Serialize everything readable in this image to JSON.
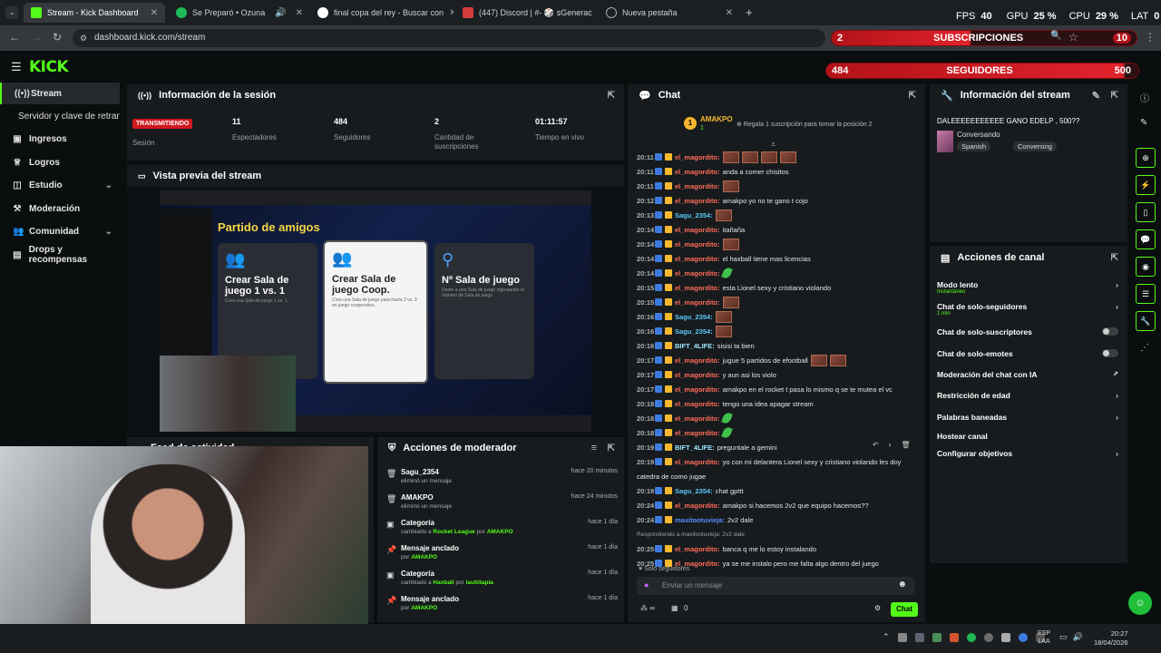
{
  "browser": {
    "tabs": [
      {
        "title": "Stream - Kick Dashboard"
      },
      {
        "title": "Se Preparó • Ozuna"
      },
      {
        "title": "final copa del rey - Buscar con"
      },
      {
        "title": "(447) Discord | #- 🎲 ꜱGenerac"
      },
      {
        "title": "Nueva pestaña"
      }
    ],
    "url": "dashboard.kick.com/stream",
    "new_tab": "+"
  },
  "overlay": {
    "fps_label": "FPS",
    "fps": "40",
    "gpu_label": "GPU",
    "gpu": "25 %",
    "cpu_label": "CPU",
    "cpu": "29 %",
    "lat_label": "LAT",
    "lat": "0",
    "subs_current": "2",
    "subs_label": "SUBSCRIPCIONES",
    "subs_goal": "10",
    "followers_current": "484",
    "followers_label": "SEGUIDORES",
    "followers_goal": "500"
  },
  "sidebar": {
    "items": [
      {
        "label": "Stream"
      },
      {
        "label": "Servidor y clave de retransm"
      },
      {
        "label": "Ingresos"
      },
      {
        "label": "Logros"
      },
      {
        "label": "Estudio"
      },
      {
        "label": "Moderación"
      },
      {
        "label": "Comunidad"
      },
      {
        "label": "Drops y recompensas"
      }
    ]
  },
  "session": {
    "title": "Información de la sesión",
    "status": "TRANSMITIENDO",
    "status_label": "Sesión",
    "viewers": "11",
    "viewers_label": "Espectadores",
    "followers": "484",
    "followers_label": "Seguidores",
    "subs": "2",
    "subs_label": "Cantidad de suscripciones",
    "live_time": "01:11:57",
    "live_label": "Tiempo en vivo"
  },
  "preview": {
    "title": "Vista previa del stream",
    "game_title": "Partido de amigos",
    "cards": [
      {
        "title": "Crear Sala de juego 1 vs. 1",
        "desc": "Crea una Sala de juego 1 vs. 1."
      },
      {
        "title": "Crear Sala de juego Coop.",
        "desc": "Crea una Sala de juego para hasta 3 vs. 3 en juego cooperativo."
      },
      {
        "title": "Nº Sala de juego",
        "desc": "Únete a una Sala de juego ingresando el número de Sala de juego."
      }
    ]
  },
  "activity_feed": {
    "title": "Feed de actividad"
  },
  "mod_actions": {
    "title": "Acciones de moderador",
    "items": [
      {
        "title": "Sagu_2354",
        "desc": "eliminó un mensaje",
        "when": "hace 20 minutos",
        "by": ""
      },
      {
        "title": "AMAKPO",
        "desc": "eliminó un mensaje",
        "when": "hace 24 minutos",
        "by": ""
      },
      {
        "title": "Categoría",
        "desc": "cambiado a",
        "target": "Rocket League",
        "by_word": "por",
        "by": "AMAKPO",
        "when": "hace 1 día"
      },
      {
        "title": "Mensaje anclado",
        "desc": "por",
        "by": "AMAKPO",
        "when": "hace 1 día"
      },
      {
        "title": "Categoría",
        "desc": "cambiado a",
        "target": "Haxball",
        "by_word": "por",
        "by": "lautiitapia",
        "when": "hace 1 día"
      },
      {
        "title": "Mensaje anclado",
        "desc": "por",
        "by": "AMAKPO",
        "when": "hace 1 día"
      }
    ]
  },
  "chat": {
    "title": "Chat",
    "top_gifter": "AMAKPO",
    "top_gifter_rank": "1",
    "top_gifter_count": "1",
    "gift_promo": "Regala 1 suscripción para tomar la posición 2",
    "messages": [
      {
        "time": "20:11",
        "user": "el_magordito",
        "color": "#ff6b5a",
        "text": "",
        "emotes": 4
      },
      {
        "time": "20:11",
        "user": "el_magordito",
        "color": "#ff6b5a",
        "text": "anda a comer chisitos"
      },
      {
        "time": "20:11",
        "user": "el_magordito",
        "color": "#ff6b5a",
        "text": "",
        "emotes": 1
      },
      {
        "time": "20:12",
        "user": "el_magordito",
        "color": "#ff6b5a",
        "text": "amakpo yo no te gano t cojo"
      },
      {
        "time": "20:13",
        "user": "Sagu_2354",
        "color": "#5ac8fa",
        "text": "",
        "emotes": 1
      },
      {
        "time": "20:14",
        "user": "el_magordito",
        "color": "#ff6b5a",
        "text": "itañaña"
      },
      {
        "time": "20:14",
        "user": "el_magordito",
        "color": "#ff6b5a",
        "text": "",
        "emotes": 1
      },
      {
        "time": "20:14",
        "user": "el_magordito",
        "color": "#ff6b5a",
        "text": "el haxball tiene mas licencias"
      },
      {
        "time": "20:14",
        "user": "el_magordito",
        "color": "#ff6b5a",
        "text": "",
        "leaf": true
      },
      {
        "time": "20:15",
        "user": "el_magordito",
        "color": "#ff6b5a",
        "text": "esta Lionel sexy y cristiano violando"
      },
      {
        "time": "20:15",
        "user": "el_magordito",
        "color": "#ff6b5a",
        "text": "",
        "emotes": 1
      },
      {
        "time": "20:16",
        "user": "Sagu_2354",
        "color": "#5ac8fa",
        "text": "",
        "emotes": 1
      },
      {
        "time": "20:16",
        "user": "Sagu_2354",
        "color": "#5ac8fa",
        "text": "",
        "emotes": 1
      },
      {
        "time": "20:16",
        "user": "BIFT_4LIFE",
        "color": "#9be7ff",
        "text": "sisisi ta bien"
      },
      {
        "time": "20:17",
        "user": "el_magordito",
        "color": "#ff6b5a",
        "text": "jugue 5 partidos de efootball",
        "emotes": 2
      },
      {
        "time": "20:17",
        "user": "el_magordito",
        "color": "#ff6b5a",
        "text": "y aun asi los violo"
      },
      {
        "time": "20:17",
        "user": "el_magordito",
        "color": "#ff6b5a",
        "text": "amakpo en el rocket t pasa lo mismo q se te mutea el vc"
      },
      {
        "time": "20:18",
        "user": "el_magordito",
        "color": "#ff6b5a",
        "text": "tengo una idea apagar stream"
      },
      {
        "time": "20:18",
        "user": "el_magordito",
        "color": "#ff6b5a",
        "text": "",
        "leaf": true
      },
      {
        "time": "20:18",
        "user": "el_magordito",
        "color": "#ff6b5a",
        "text": "",
        "leaf": true
      },
      {
        "time": "20:19",
        "user": "BIFT_4LIFE",
        "color": "#9be7ff",
        "text": "preguntale a gemini"
      },
      {
        "time": "20:19",
        "user": "el_magordito",
        "color": "#ff6b5a",
        "text": "yo con mi delantera Lionel sexy y cristiano violando les doy"
      },
      {
        "time": "",
        "user": "",
        "color": "#ff6b5a",
        "text": "catedra de como jugae"
      },
      {
        "time": "20:19",
        "user": "Sagu_2354",
        "color": "#5ac8fa",
        "text": "chat gpttt"
      },
      {
        "time": "20:24",
        "user": "el_magordito",
        "color": "#ff6b5a",
        "text": "amakpo si hacemos 2v2 que equipo hacemos??"
      },
      {
        "time": "20:24",
        "user": "maxitootuvieja",
        "color": "#5a8cff",
        "text": "2v2 dale"
      },
      {
        "time": "",
        "user": "",
        "color": "#9aa0a4",
        "text": "Respondiendo a maxitootuvieja: 2v2 dale",
        "reply": true
      },
      {
        "time": "20:25",
        "user": "el_magordito",
        "color": "#ff6b5a",
        "text": "banca q me lo estoy instalando"
      },
      {
        "time": "20:25",
        "user": "el_magordito",
        "color": "#ff6b5a",
        "text": "ya se me instalo pero me falta algo dentro del juego"
      }
    ],
    "followers_only": "Solo seguidores",
    "input_placeholder": "Enviar un mensaje",
    "points": "0",
    "send_label": "Chat"
  },
  "stream_info": {
    "title": "Información del stream",
    "stream_title": "DALEEEEEEEEEEE GANO EDELP , 500??",
    "category": "Conversando",
    "tags": [
      "Spanish",
      "Conversing"
    ]
  },
  "channel_actions": {
    "title": "Acciones de canal",
    "items": [
      {
        "label": "Modo lento",
        "sub": "Instantáneo",
        "kind": "arrow"
      },
      {
        "label": "Chat de solo-seguidores",
        "sub": "1 min",
        "kind": "arrow"
      },
      {
        "label": "Chat de solo-suscriptores",
        "sub": "",
        "kind": "toggle"
      },
      {
        "label": "Chat de solo-emotes",
        "sub": "",
        "kind": "toggle"
      },
      {
        "label": "Moderación del chat con IA",
        "sub": "",
        "kind": "external"
      },
      {
        "label": "Restricción de edad",
        "sub": "",
        "kind": "arrow"
      },
      {
        "label": "Palabras baneadas",
        "sub": "",
        "kind": "arrow"
      },
      {
        "label": "Hostear canal",
        "sub": "",
        "kind": "none"
      },
      {
        "label": "Configurar objetivos",
        "sub": "",
        "kind": "arrow"
      }
    ]
  },
  "taskbar": {
    "lang": "ESP",
    "layout": "LAA",
    "time": "20:27",
    "date": "18/04/2026"
  },
  "colors": {
    "accent": "#53fc18",
    "live": "#d01920",
    "panel": "#171b1d",
    "bg": "#0b0e0f"
  }
}
